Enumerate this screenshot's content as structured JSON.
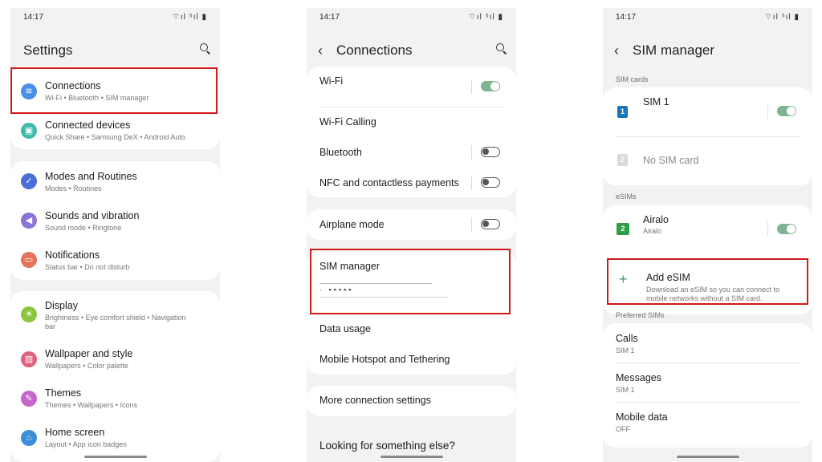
{
  "status": {
    "time": "14:17",
    "icons": "⌔ıl ⁵ıl ▮"
  },
  "panel1": {
    "title": "Settings",
    "items": [
      {
        "title": "Connections",
        "subtitle": "Wi-Fi  •  Bluetooth  •  SIM manager",
        "icon": "wifi-icon",
        "color": "#4a8fe7"
      },
      {
        "title": "Connected devices",
        "subtitle": "Quick Share  •  Samsung DeX  •  Android Auto",
        "icon": "devices-icon",
        "color": "#3fbba8"
      },
      {
        "title": "Modes and Routines",
        "subtitle": "Modes  •  Routines",
        "icon": "routines-icon",
        "color": "#4c6fd6"
      },
      {
        "title": "Sounds and vibration",
        "subtitle": "Sound mode  •  Ringtone",
        "icon": "speaker-icon",
        "color": "#8b73d8"
      },
      {
        "title": "Notifications",
        "subtitle": "Status bar  •  Do not disturb",
        "icon": "notification-icon",
        "color": "#e8735a"
      },
      {
        "title": "Display",
        "subtitle_line1": "Brightness  •  Eye comfort shield  •  Navigation",
        "subtitle_line2": "bar",
        "icon": "brightness-icon",
        "color": "#8cc63f"
      },
      {
        "title": "Wallpaper and style",
        "subtitle": "Wallpapers  •  Color palette",
        "icon": "wallpaper-icon",
        "color": "#e0607e"
      },
      {
        "title": "Themes",
        "subtitle": "Themes  •  Wallpapers  •  Icons",
        "icon": "themes-icon",
        "color": "#c566c9"
      },
      {
        "title": "Home screen",
        "subtitle": "Layout  •  App icon badges",
        "icon": "home-icon",
        "color": "#3a8fd8"
      }
    ]
  },
  "panel2": {
    "title": "Connections",
    "wifi": "Wi-Fi",
    "wifi_calling": "Wi-Fi Calling",
    "bluetooth": "Bluetooth",
    "nfc": "NFC and contactless payments",
    "airplane": "Airplane mode",
    "sim_manager": "SIM manager",
    "data_usage": "Data usage",
    "hotspot": "Mobile Hotspot and Tethering",
    "more": "More connection settings",
    "looking": "Looking for something else?",
    "toggles": {
      "wifi": true,
      "bluetooth": false,
      "nfc": false,
      "airplane": false
    }
  },
  "panel3": {
    "title": "SIM manager",
    "sim_cards_label": "SIM cards",
    "sim1": "SIM 1",
    "sim1_badge": "1",
    "no_sim": "No SIM card",
    "no_sim_badge": "2",
    "esims_label": "eSIMs",
    "airalo": "Airalo",
    "airalo_sub": "Airalo",
    "airalo_badge": "2",
    "add_esim": "Add eSIM",
    "add_esim_sub1": "Download an eSIM so you can connect to",
    "add_esim_sub2": "mobile networks without a SIM card.",
    "preferred_label": "Preferred SIMs",
    "calls": "Calls",
    "calls_val": "SIM 1",
    "messages": "Messages",
    "messages_val": "SIM 1",
    "mobile_data": "Mobile data",
    "mobile_data_val": "OFF",
    "toggles": {
      "sim1": true,
      "airalo": true
    }
  },
  "colors": {
    "highlight": "#d11a1a",
    "toggle_on": "#7fb392",
    "sim_blue": "#1976b8",
    "esim_green": "#2e9d4a"
  }
}
